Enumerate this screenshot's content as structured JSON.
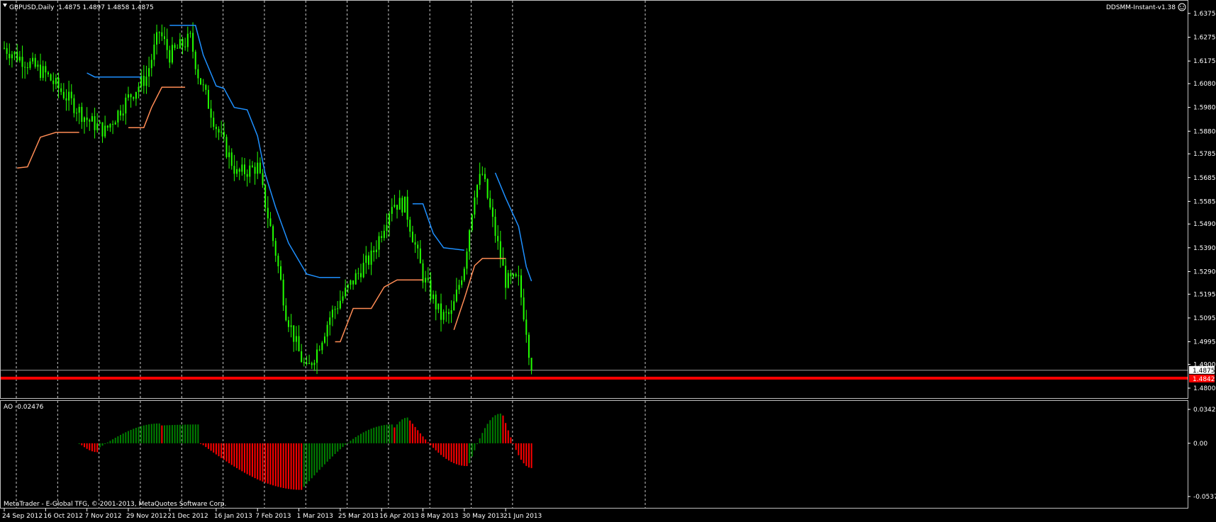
{
  "colors": {
    "background": "#000000",
    "frame": "#c0c0c0",
    "grid": "#c8c8c8",
    "candle": "#22ff00",
    "upper_stop": "#1e90ff",
    "lower_stop": "#ff8c55",
    "support_line": "#ff0000",
    "ao_up": "#008000",
    "ao_down": "#ff0000",
    "bid_tag_bg": "#ffffff",
    "support_tag_bg": "#ff0000"
  },
  "header": {
    "menu_icon": "triangle-down-icon",
    "symbol_info": "GBPUSD,Daily  1.4875 1.4897 1.4858 1.4875",
    "indicator_name": "DDSMM-Instant-v1.38",
    "indicator_icon": "smiley-icon"
  },
  "price_axis": {
    "ticks": [
      "1.6375",
      "1.6275",
      "1.6175",
      "1.6080",
      "1.5980",
      "1.5880",
      "1.5785",
      "1.5685",
      "1.5585",
      "1.5490",
      "1.5390",
      "1.5290",
      "1.5195",
      "1.5095",
      "1.4995",
      "1.4900",
      "1.4800"
    ],
    "current_price": "1.4875",
    "support_price": "1.4842"
  },
  "ao_panel": {
    "label": "AO -0.02476",
    "axis_ticks": [
      "0.03421",
      "0.00",
      "-0.05371"
    ]
  },
  "time_axis": {
    "labels": [
      "24 Sep 2012",
      "16 Oct 2012",
      "7 Nov 2012",
      "29 Nov 2012",
      "21 Dec 2012",
      "16 Jan 2013",
      "7 Feb 2013",
      "1 Mar 2013",
      "25 Mar 2013",
      "16 Apr 2013",
      "8 May 2013",
      "30 May 2013",
      "21 Jun 2013"
    ]
  },
  "footer": {
    "copyright": "MetaTrader - E-Global TFG, © 2001-2013, MetaQuotes Software Corp."
  },
  "chart_data": {
    "type": "candlestick",
    "symbol": "GBPUSD",
    "timeframe": "Daily",
    "last_bar": {
      "open": 1.4875,
      "high": 1.4897,
      "low": 1.4858,
      "close": 1.4875
    },
    "price_range": [
      1.4775,
      1.6425
    ],
    "support_level": 1.4842,
    "close_path": [
      [
        "24 Sep 2012",
        1.623
      ],
      [
        "16 Oct 2012",
        1.612
      ],
      [
        "7 Nov 2012",
        1.593
      ],
      [
        "16 Nov 2012",
        1.588
      ],
      [
        "29 Nov 2012",
        1.602
      ],
      [
        "10 Dec 2012",
        1.611
      ],
      [
        "17 Dec 2012",
        1.63
      ],
      [
        "21 Dec 2012",
        1.62
      ],
      [
        "2 Jan 2013",
        1.627
      ],
      [
        "7 Jan 2013",
        1.612
      ],
      [
        "16 Jan 2013",
        1.59
      ],
      [
        "28 Jan 2013",
        1.57
      ],
      [
        "7 Feb 2013",
        1.573
      ],
      [
        "18 Feb 2013",
        1.537
      ],
      [
        "22 Feb 2013",
        1.512
      ],
      [
        "1 Mar 2013",
        1.495
      ],
      [
        "6 Mar 2013",
        1.487
      ],
      [
        "12 Mar 2013",
        1.496
      ],
      [
        "19 Mar 2013",
        1.51
      ],
      [
        "25 Mar 2013",
        1.517
      ],
      [
        "4 Apr 2013",
        1.53
      ],
      [
        "10 Apr 2013",
        1.535
      ],
      [
        "16 Apr 2013",
        1.546
      ],
      [
        "22 Apr 2013",
        1.558
      ],
      [
        "29 Apr 2013",
        1.557
      ],
      [
        "8 May 2013",
        1.527
      ],
      [
        "17 May 2013",
        1.51
      ],
      [
        "23 May 2013",
        1.511
      ],
      [
        "30 May 2013",
        1.532
      ],
      [
        "5 Jun 2013",
        1.563
      ],
      [
        "10 Jun 2013",
        1.57
      ],
      [
        "17 Jun 2013",
        1.545
      ],
      [
        "21 Jun 2013",
        1.525
      ],
      [
        "28 Jun 2013",
        1.525
      ],
      [
        "3 Jul 2013",
        1.505
      ],
      [
        "5 Jul 2013",
        1.4875
      ]
    ],
    "upper_stop": [
      [
        [
          "7 Nov 2012",
          1.6125
        ],
        [
          "10 Nov 2012",
          1.6108
        ],
        [
          "6 Dec 2012",
          1.6108
        ]
      ],
      [
        [
          "21 Dec 2012",
          1.6325
        ],
        [
          "26 Dec 2012",
          1.6325
        ],
        [
          "4 Jan 2013",
          1.6325
        ],
        [
          "9 Jan 2013",
          1.62
        ],
        [
          "16 Jan 2013",
          1.607
        ],
        [
          "21 Jan 2013",
          1.606
        ],
        [
          "25 Jan 2013",
          1.598
        ],
        [
          "1 Feb 2013",
          1.597
        ],
        [
          "7 Feb 2013",
          1.586
        ],
        [
          "12 Feb 2013",
          1.57
        ],
        [
          "18 Feb 2013",
          1.556
        ],
        [
          "25 Feb 2013",
          1.541
        ],
        [
          "6 Mar 2013",
          1.528
        ],
        [
          "13 Mar 2013",
          1.5265
        ],
        [
          "25 Mar 2013",
          1.5265
        ]
      ],
      [
        [
          "2 May 2013",
          1.5575
        ],
        [
          "8 May 2013",
          1.5575
        ],
        [
          "14 May 2013",
          1.545
        ],
        [
          "20 May 2013",
          1.539
        ],
        [
          "30 May 2013",
          1.538
        ]
      ],
      [
        [
          "17 Jun 2013",
          1.5705
        ],
        [
          "21 Jun 2013",
          1.56
        ],
        [
          "28 Jun 2013",
          1.548
        ],
        [
          "3 Jul 2013",
          1.531
        ],
        [
          "5 Jul 2013",
          1.525
        ]
      ]
    ],
    "lower_stop": [
      [
        [
          "1 Oct 2012",
          1.5725
        ],
        [
          "5 Oct 2012",
          1.573
        ],
        [
          "12 Oct 2012",
          1.5855
        ],
        [
          "22 Oct 2012",
          1.5875
        ],
        [
          "2 Nov 2012",
          1.5875
        ]
      ],
      [
        [
          "29 Nov 2012",
          1.5895
        ],
        [
          "7 Dec 2012",
          1.5895
        ],
        [
          "12 Dec 2012",
          1.598
        ],
        [
          "18 Dec 2012",
          1.6065
        ],
        [
          "29 Dec 2012",
          1.6065
        ]
      ],
      [
        [
          "21 Mar 2013",
          1.4995
        ],
        [
          "25 Mar 2013",
          1.4995
        ],
        [
          "1 Apr 2013",
          1.5135
        ],
        [
          "10 Apr 2013",
          1.5135
        ],
        [
          "17 Apr 2013",
          1.5225
        ],
        [
          "24 Apr 2013",
          1.5255
        ],
        [
          "8 May 2013",
          1.5255
        ]
      ],
      [
        [
          "24 May 2013",
          1.5045
        ],
        [
          "30 May 2013",
          1.5175
        ],
        [
          "5 Jun 2013",
          1.5315
        ],
        [
          "10 Jun 2013",
          1.5345
        ],
        [
          "21 Jun 2013",
          1.5345
        ]
      ]
    ],
    "awesome_oscillator": {
      "current": -0.02476,
      "range": [
        -0.05371,
        0.03421
      ],
      "phases": [
        {
          "from": "2 Nov 2012",
          "to": "13 Nov 2012",
          "start": 0.0,
          "peak": -0.009,
          "end": -0.004
        },
        {
          "from": "14 Nov 2012",
          "to": "17 Dec 2012",
          "start": -0.004,
          "peak": 0.02,
          "end": 0.018
        },
        {
          "from": "18 Dec 2012",
          "to": "7 Jan 2013",
          "start": 0.018,
          "peak": 0.019,
          "end": 0.0
        },
        {
          "from": "8 Jan 2013",
          "to": "4 Mar 2013",
          "start": 0.0,
          "peak": -0.047,
          "end": -0.044
        },
        {
          "from": "5 Mar 2013",
          "to": "22 Apr 2013",
          "start": -0.044,
          "peak": 0.019,
          "end": 0.016
        },
        {
          "from": "23 Apr 2013",
          "to": "30 Apr 2013",
          "start": 0.016,
          "peak": 0.026,
          "end": 0.023
        },
        {
          "from": "1 May 2013",
          "to": "31 May 2013",
          "start": 0.023,
          "peak": -0.023,
          "end": -0.02
        },
        {
          "from": "3 Jun 2013",
          "to": "19 Jun 2013",
          "start": -0.02,
          "peak": 0.03,
          "end": 0.028
        },
        {
          "from": "20 Jun 2013",
          "to": "5 Jul 2013",
          "start": 0.028,
          "peak": -0.025,
          "end": -0.025
        }
      ]
    }
  }
}
